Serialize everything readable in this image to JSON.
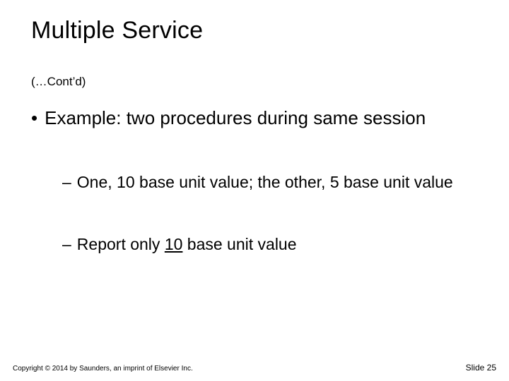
{
  "title": "Multiple Service",
  "contd": "(…Cont’d)",
  "bullet_main": "Example: two procedures during same session",
  "sub_bullets": [
    "One, 10 base unit value; the other, 5 base unit value",
    {
      "prefix": "Report only ",
      "underlined": "10",
      "suffix": " base unit value"
    }
  ],
  "footer": {
    "copyright": "Copyright © 2014 by Saunders, an imprint of Elsevier Inc.",
    "slide_label": "Slide 25"
  }
}
